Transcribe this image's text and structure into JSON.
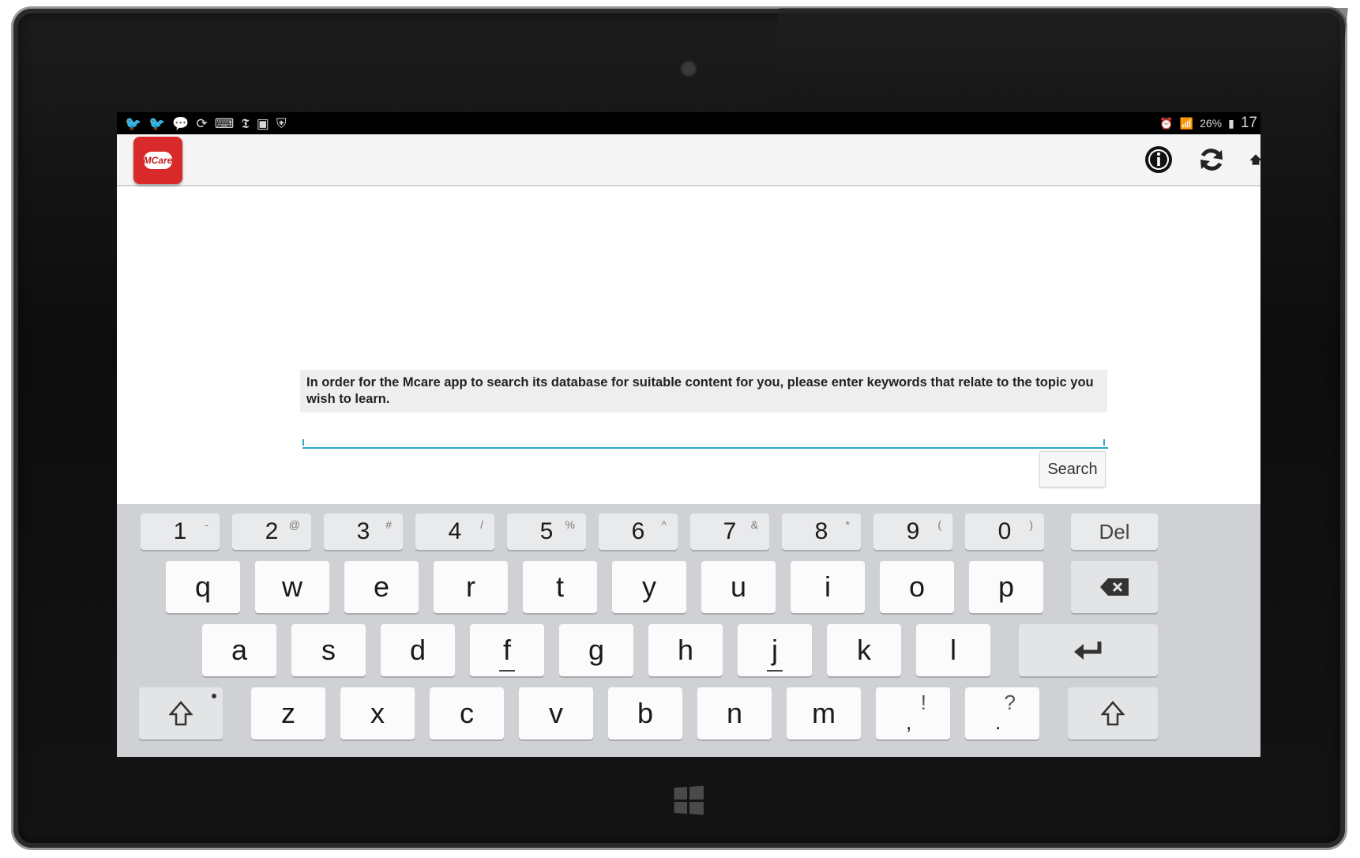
{
  "status_bar": {
    "left_icons": [
      "twitter-icon",
      "twitter-icon",
      "chat-icon",
      "sync-icon",
      "keyboard-icon",
      "nyt-icon",
      "gallery-icon",
      "shield-icon"
    ],
    "battery": "26%",
    "clock": "17"
  },
  "action_bar": {
    "app_badge": "MCare"
  },
  "content": {
    "prompt": "In order for the Mcare app to search its database for suitable content for you, please enter keywords that relate to the topic you wish to learn.",
    "search_value": "",
    "search_button": "Search"
  },
  "keyboard": {
    "number_row": [
      {
        "k": "1",
        "h": "-"
      },
      {
        "k": "2",
        "h": "@"
      },
      {
        "k": "3",
        "h": "#"
      },
      {
        "k": "4",
        "h": "/"
      },
      {
        "k": "5",
        "h": "%"
      },
      {
        "k": "6",
        "h": "^"
      },
      {
        "k": "7",
        "h": "&"
      },
      {
        "k": "8",
        "h": "*"
      },
      {
        "k": "9",
        "h": "("
      },
      {
        "k": "0",
        "h": ")"
      }
    ],
    "del_label": "Del",
    "row1": [
      "q",
      "w",
      "e",
      "r",
      "t",
      "y",
      "u",
      "i",
      "o",
      "p"
    ],
    "row2": [
      "a",
      "s",
      "d",
      "f",
      "g",
      "h",
      "j",
      "k",
      "l"
    ],
    "row3": [
      "z",
      "x",
      "c",
      "v",
      "b",
      "n",
      "m"
    ],
    "comma_key": {
      "main": ",",
      "alt": "!"
    },
    "period_key": {
      "main": ".",
      "alt": "?"
    }
  }
}
